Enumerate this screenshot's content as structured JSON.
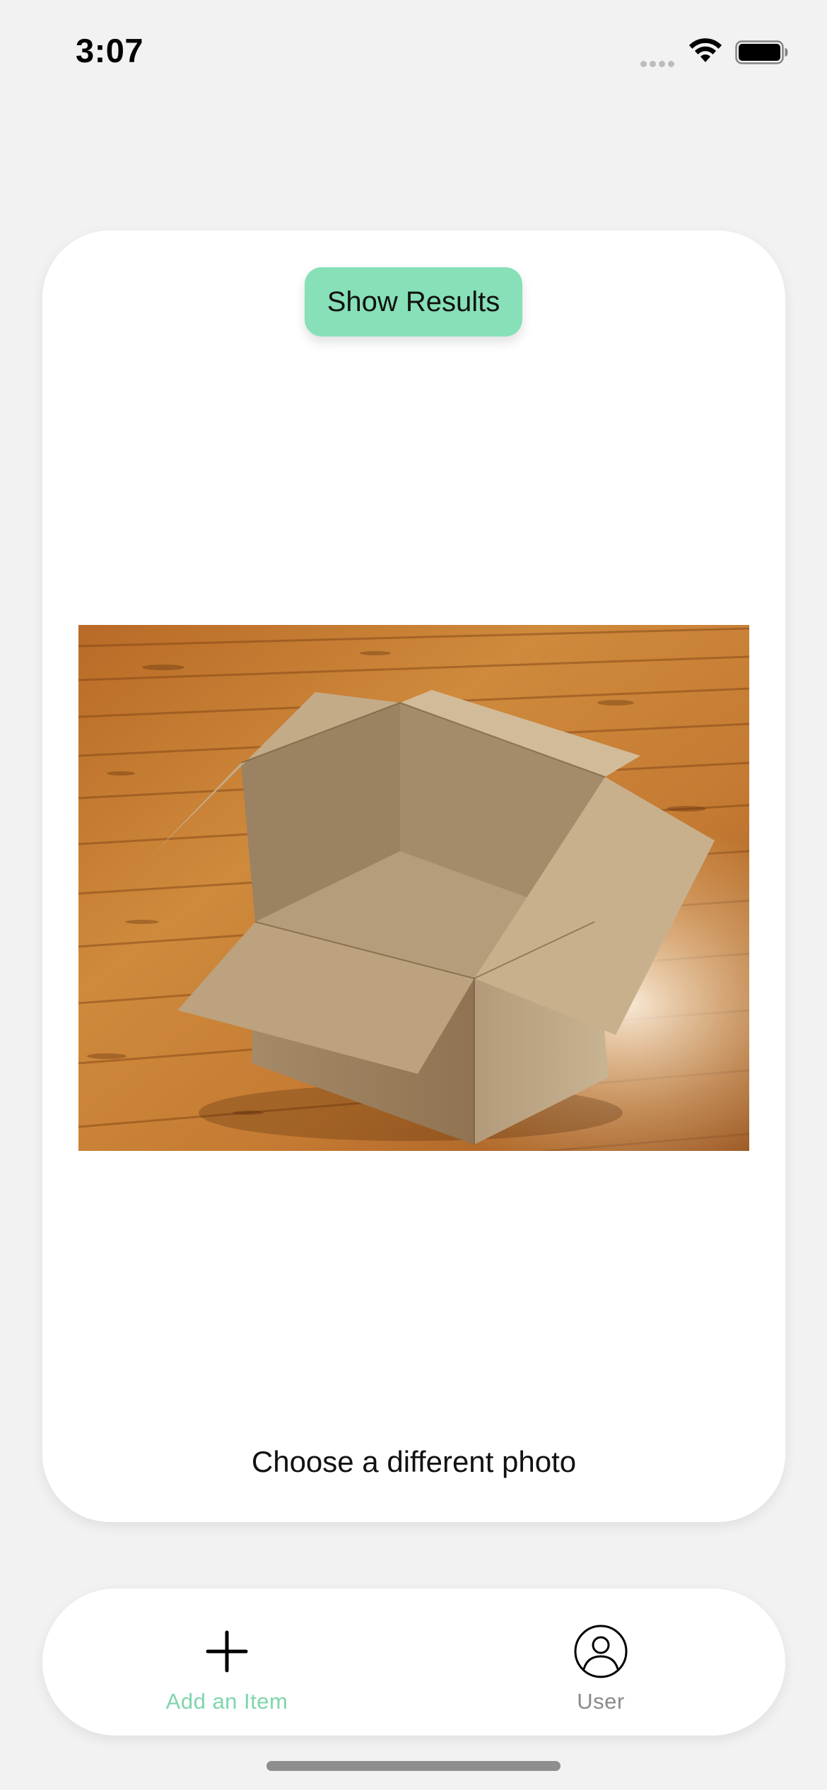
{
  "status_bar": {
    "time": "3:07",
    "icons": [
      "signal-dots-icon",
      "wifi-icon",
      "battery-icon"
    ]
  },
  "main_card": {
    "show_results_label": "Show Results",
    "photo_subject": "open-cardboard-box-on-wood-floor",
    "choose_photo_label": "Choose a different photo"
  },
  "tab_bar": {
    "items": [
      {
        "label": "Add an Item",
        "icon": "plus-icon",
        "active": true
      },
      {
        "label": "User",
        "icon": "user-circle-icon",
        "active": false
      }
    ]
  },
  "colors": {
    "accent": "#87e0b7",
    "active_tab_label": "#7ed6ac",
    "inactive_tab_label": "#8a8a8a",
    "background": "#f2f2f2"
  }
}
